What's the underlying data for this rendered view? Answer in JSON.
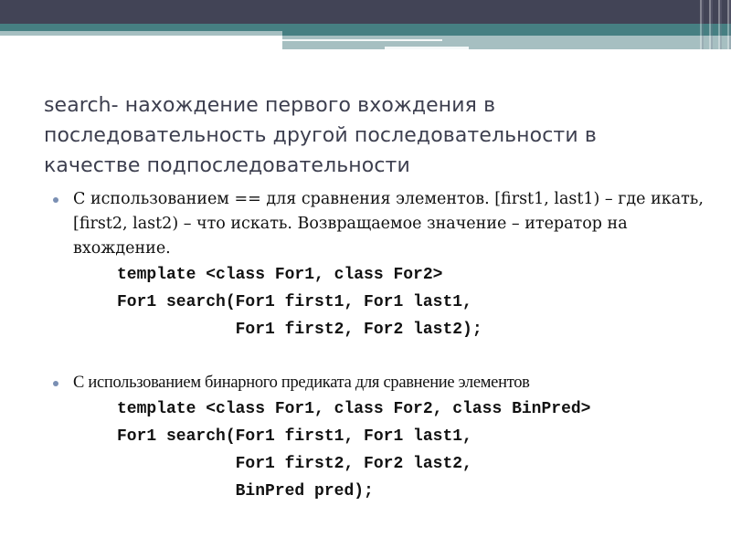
{
  "slide": {
    "title": "search- нахождение первого вхождения в последовательность другой последовательности в качестве подпоследовательности",
    "sections": [
      {
        "bullet": "С использованием == для сравнения элементов. [first1, last1) – где икать, [first2, last2) – что искать. Возвращаемое значение – итератор на вхождение.",
        "code": [
          "template <class For1, class For2>",
          "For1 search(For1 first1, For1 last1,",
          "            For1 first2, For2 last2);"
        ]
      },
      {
        "bullet": "С использованием бинарного предиката для сравнение элементов",
        "code": [
          "template <class For1, class For2, class BinPred>",
          "For1 search(For1 first1, For1 last1,",
          "            For1 first2, For2 last2,",
          "            BinPred pred);"
        ]
      }
    ]
  },
  "colors": {
    "header_dark": "#424456",
    "header_teal": "#467f82",
    "header_light": "#a6bfc1",
    "title_text": "#3d3f4f",
    "bullet_dot": "#7a8fb3"
  }
}
